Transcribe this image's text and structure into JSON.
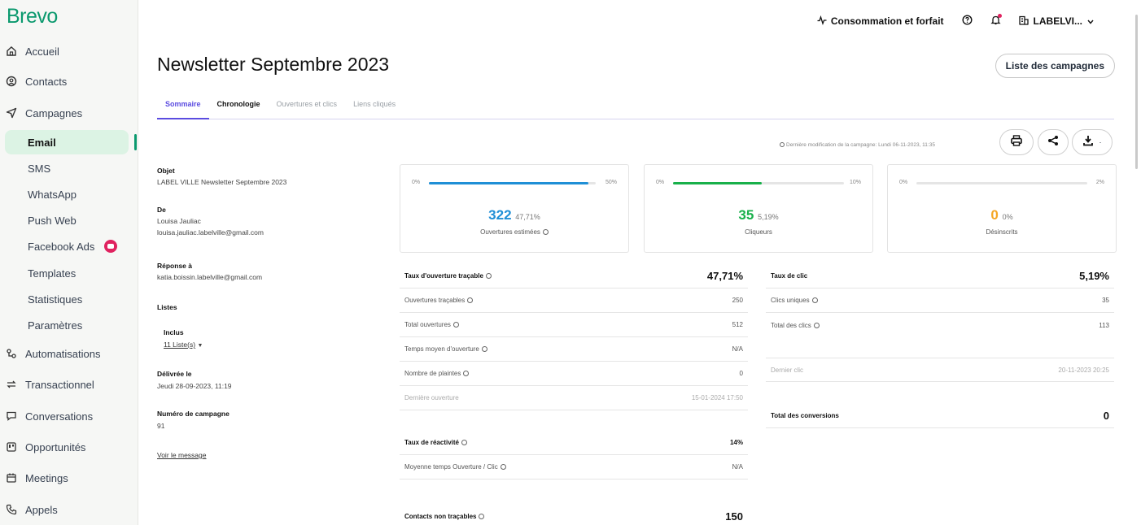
{
  "brand": "Brevo",
  "sidebar": {
    "items": [
      {
        "label": "Accueil",
        "icon": "home-icon"
      },
      {
        "label": "Contacts",
        "icon": "contacts-icon"
      },
      {
        "label": "Campagnes",
        "icon": "send-icon"
      },
      {
        "label": "Email"
      },
      {
        "label": "SMS"
      },
      {
        "label": "WhatsApp"
      },
      {
        "label": "Push Web"
      },
      {
        "label": "Facebook Ads"
      },
      {
        "label": "Templates"
      },
      {
        "label": "Statistiques"
      },
      {
        "label": "Paramètres"
      },
      {
        "label": "Automatisations",
        "icon": "automation-icon"
      },
      {
        "label": "Transactionnel",
        "icon": "transactional-icon"
      },
      {
        "label": "Conversations",
        "icon": "chat-icon"
      },
      {
        "label": "Opportunités",
        "icon": "deals-icon"
      },
      {
        "label": "Meetings",
        "icon": "calendar-icon"
      },
      {
        "label": "Appels",
        "icon": "phone-icon"
      }
    ]
  },
  "topbar": {
    "consumption": "Consommation et forfait",
    "account": "LABELVI..."
  },
  "page": {
    "title": "Newsletter Septembre 2023",
    "list_button": "Liste des campagnes"
  },
  "tabs": [
    "Sommaire",
    "Chronologie",
    "Ouvertures et clics",
    "Liens cliqués"
  ],
  "last_modified": "Dernière modification de la campagne: Lundi 06-11-2023, 11:35",
  "info": {
    "objet_label": "Objet",
    "objet": "LABEL VILLE Newsletter Septembre 2023",
    "de_label": "De",
    "de_name": "Louisa Jauliac",
    "de_email": "louisa.jauliac.labelville@gmail.com",
    "reponse_label": "Réponse à",
    "reponse": "katia.boissin.labelville@gmail.com",
    "listes_label": "Listes",
    "inclus_label": "Inclus",
    "inclus_value": "11 Liste(s)",
    "delivree_label": "Délivrée le",
    "delivree": "Jeudi 28-09-2023, 11:19",
    "numero_label": "Numéro de campagne",
    "numero": "91",
    "voir": "Voir le message"
  },
  "cards": [
    {
      "min": "0%",
      "max": "50%",
      "value": "322",
      "percent": "47,71%",
      "label": "Ouvertures estimées",
      "fill": 0.954,
      "color": "#1f8fd6"
    },
    {
      "min": "0%",
      "max": "10%",
      "value": "35",
      "percent": "5,19%",
      "label": "Cliqueurs",
      "fill": 0.519,
      "color": "#18b04a"
    },
    {
      "min": "0%",
      "max": "2%",
      "value": "0",
      "percent": "0%",
      "label": "Désinscrits",
      "fill": 0,
      "color": "#f5a623"
    }
  ],
  "left_table": [
    {
      "label": "Taux d'ouverture traçable",
      "value": "47,71%",
      "head": true
    },
    {
      "label": "Ouvertures traçables",
      "value": "250"
    },
    {
      "label": "Total ouvertures",
      "value": "512"
    },
    {
      "label": "Temps moyen d'ouverture",
      "value": "N/A"
    },
    {
      "label": "Nombre de plaintes",
      "value": "0"
    },
    {
      "label": "Dernière ouverture",
      "value": "15-01-2024 17:50"
    },
    {
      "label": "Taux de réactivité",
      "value": "14%"
    },
    {
      "label": "Moyenne temps Ouverture / Clic",
      "value": "N/A"
    },
    {
      "label": "Contacts non traçables",
      "value": "150"
    }
  ],
  "right_table": [
    {
      "label": "Taux de clic",
      "value": "5,19%"
    },
    {
      "label": "Clics uniques",
      "value": "35"
    },
    {
      "label": "Total des clics",
      "value": "113"
    },
    {
      "label": "Dernier clic",
      "value": "20-11-2023 20:25"
    },
    {
      "label": "Total des conversions",
      "value": "0"
    }
  ]
}
